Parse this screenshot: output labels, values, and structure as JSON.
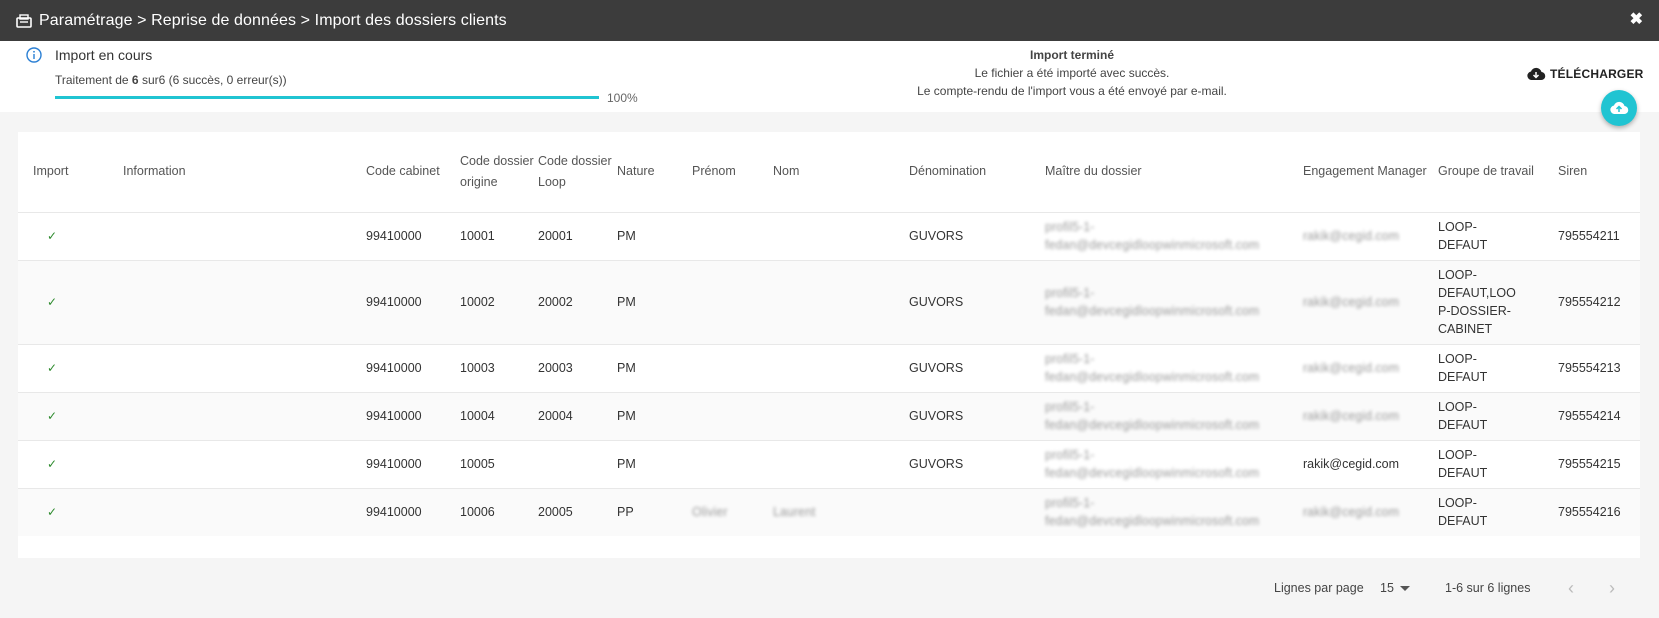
{
  "window": {
    "title": "Paramétrage > Reprise de données > Import des dossiers clients",
    "close_label": "✖",
    "icon": "import-icon"
  },
  "import_status": {
    "title": "Import en cours",
    "sub_prefix": "Traitement de ",
    "sub_count": "6",
    "sub_suffix": " sur6 (6 succès, 0 erreur(s))",
    "progress_fraction": 1.0,
    "percent_label": "100%"
  },
  "import_done": {
    "title": "Import terminé",
    "line1": "Le fichier a été importé avec succès.",
    "line2": "Le compte-rendu de l'import vous a été envoyé par e-mail."
  },
  "toolbar": {
    "download_label": "TÉLÉCHARGER",
    "download_icon": "cloud-download-icon",
    "upload_icon": "cloud-upload-icon",
    "accent": "#20c4d2"
  },
  "table": {
    "headers": {
      "import": "Import",
      "information": "Information",
      "code_cabinet": "Code cabinet",
      "code_dossier_origine": "Code dossier origine",
      "code_dossier_loop": "Code dossier Loop",
      "nature": "Nature",
      "prenom": "Prénom",
      "nom": "Nom",
      "denomination": "Dénomination",
      "maitre": "Maître du dossier",
      "engagement": "Engagement Manager",
      "groupe": "Groupe de travail",
      "siren": "Siren"
    },
    "rows": [
      {
        "import": "✓",
        "information": "",
        "code_cabinet": "99410000",
        "origine": "10001",
        "loop": "20001",
        "nature": "PM",
        "prenom": "",
        "nom": "",
        "denomination": "GUVORS",
        "maitre_l1": "profil5-1-",
        "maitre_l2": "fedan@devcegidloopwinmicrosoft.com",
        "engagement": "rakik@cegid.com",
        "groupe": "LOOP-DEFAUT",
        "siren": "795554211"
      },
      {
        "import": "✓",
        "information": "",
        "code_cabinet": "99410000",
        "origine": "10002",
        "loop": "20002",
        "nature": "PM",
        "prenom": "",
        "nom": "",
        "denomination": "GUVORS",
        "maitre_l1": "profil5-1-",
        "maitre_l2": "fedan@devcegidloopwinmicrosoft.com",
        "engagement": "rakik@cegid.com",
        "groupe": "LOOP-DEFAUT,LOOP-DOSSIER-CABINET",
        "siren": "795554212"
      },
      {
        "import": "✓",
        "information": "",
        "code_cabinet": "99410000",
        "origine": "10003",
        "loop": "20003",
        "nature": "PM",
        "prenom": "",
        "nom": "",
        "denomination": "GUVORS",
        "maitre_l1": "profil5-1-",
        "maitre_l2": "fedan@devcegidloopwinmicrosoft.com",
        "engagement": "rakik@cegid.com",
        "groupe": "LOOP-DEFAUT",
        "siren": "795554213"
      },
      {
        "import": "✓",
        "information": "",
        "code_cabinet": "99410000",
        "origine": "10004",
        "loop": "20004",
        "nature": "PM",
        "prenom": "",
        "nom": "",
        "denomination": "GUVORS",
        "maitre_l1": "profil5-1-",
        "maitre_l2": "fedan@devcegidloopwinmicrosoft.com",
        "engagement": "rakik@cegid.com",
        "groupe": "LOOP-DEFAUT",
        "siren": "795554214"
      },
      {
        "import": "✓",
        "information": "",
        "code_cabinet": "99410000",
        "origine": "10005",
        "loop": "",
        "nature": "PM",
        "prenom": "",
        "nom": "",
        "denomination": "GUVORS",
        "maitre_l1": "profil5-1-",
        "maitre_l2": "fedan@devcegidloopwinmicrosoft.com",
        "engagement": "rakik@cegid.com",
        "groupe": "LOOP-DEFAUT",
        "siren": "795554215"
      },
      {
        "import": "✓",
        "information": "",
        "code_cabinet": "99410000",
        "origine": "10006",
        "loop": "20005",
        "nature": "PP",
        "prenom": "Olivier",
        "nom": "Laurent",
        "denomination": "",
        "maitre_l1": "profil5-1-",
        "maitre_l2": "fedan@devcegidloopwinmicrosoft.com",
        "engagement": "rakik@cegid.com",
        "groupe": "LOOP-DEFAUT",
        "siren": "795554216"
      }
    ]
  },
  "pagination": {
    "rows_per_page_label": "Lignes par page",
    "rows_per_page_value": "15",
    "range_label": "1-6 sur 6 lignes",
    "prev_label": "‹",
    "next_label": "›"
  }
}
